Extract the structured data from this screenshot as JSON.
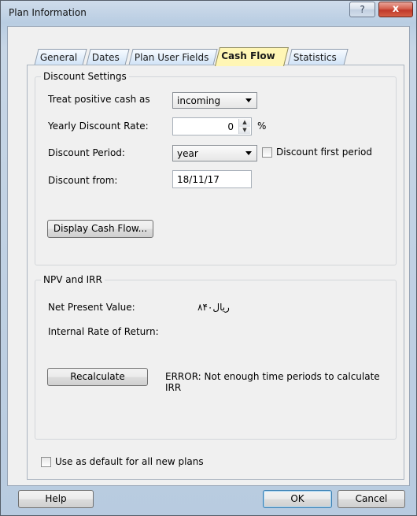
{
  "window": {
    "title": "Plan Information",
    "help_glyph": "?",
    "close_glyph": "x"
  },
  "tabs": [
    {
      "label": "General",
      "active": false
    },
    {
      "label": "Dates",
      "active": false
    },
    {
      "label": "Plan User Fields",
      "active": false
    },
    {
      "label": "Cash Flow",
      "active": true
    },
    {
      "label": "Statistics",
      "active": false
    }
  ],
  "discount_settings": {
    "title": "Discount Settings",
    "treat_label": "Treat positive cash as",
    "treat_value": "incoming",
    "rate_label": "Yearly Discount Rate:",
    "rate_value": "0",
    "rate_unit": "%",
    "period_label": "Discount Period:",
    "period_value": "year",
    "first_period_label": "Discount first period",
    "first_period_checked": false,
    "from_label": "Discount from:",
    "from_value": "18/11/17",
    "display_button": "Display Cash Flow..."
  },
  "npv_irr": {
    "title": "NPV and IRR",
    "npv_label": "Net Present Value:",
    "npv_value": "ریال۸۴۰",
    "irr_label": "Internal Rate of Return:",
    "irr_value": "",
    "recalc_button": "Recalculate",
    "error_text": "ERROR: Not enough time periods to calculate IRR"
  },
  "default_checkbox": {
    "label": "Use as default for all new plans",
    "checked": false
  },
  "footer": {
    "help": "Help",
    "ok": "OK",
    "cancel": "Cancel"
  },
  "icons": {
    "help": "question-icon",
    "close": "close-icon",
    "spin_up": "spin-up-icon",
    "spin_down": "spin-down-icon",
    "dropdown": "chevron-down-icon"
  },
  "colors": {
    "active_tab": "#fff6b5",
    "inactive_tab": "#cfe2f6",
    "close_button": "#c0392b",
    "default_button_border": "#3c7fb1"
  }
}
